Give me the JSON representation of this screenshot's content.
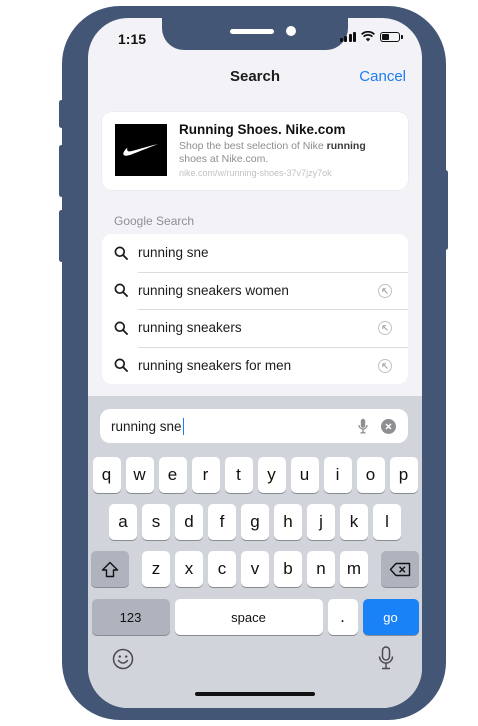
{
  "status_bar": {
    "time": "1:15"
  },
  "nav": {
    "title": "Search",
    "cancel_label": "Cancel"
  },
  "top_hit": {
    "title": "Running Shoes. Nike.com",
    "description_before": "Shop the best selection of Nike ",
    "description_bold": "running",
    "description_after": " shoes at Nike.com.",
    "url": "nike.com/w/running-shoes-37v7jzy7ok"
  },
  "google_section": {
    "label": "Google Search",
    "suggestions": [
      {
        "text": "running sne",
        "has_arrow": false
      },
      {
        "text": "running sneakers women",
        "has_arrow": true
      },
      {
        "text": "running sneakers",
        "has_arrow": true
      },
      {
        "text": "running sneakers for men",
        "has_arrow": true
      }
    ]
  },
  "search_field": {
    "value": "running sne"
  },
  "keyboard": {
    "row1": [
      "q",
      "w",
      "e",
      "r",
      "t",
      "y",
      "u",
      "i",
      "o",
      "p"
    ],
    "row2": [
      "a",
      "s",
      "d",
      "f",
      "g",
      "h",
      "j",
      "k",
      "l"
    ],
    "row3": [
      "z",
      "x",
      "c",
      "v",
      "b",
      "n",
      "m"
    ],
    "numbers_label": "123",
    "space_label": "space",
    "period_label": ".",
    "go_label": "go"
  },
  "colors": {
    "accent": "#1e7cf2",
    "frame": "#445676",
    "go_key": "#1a82f7"
  }
}
